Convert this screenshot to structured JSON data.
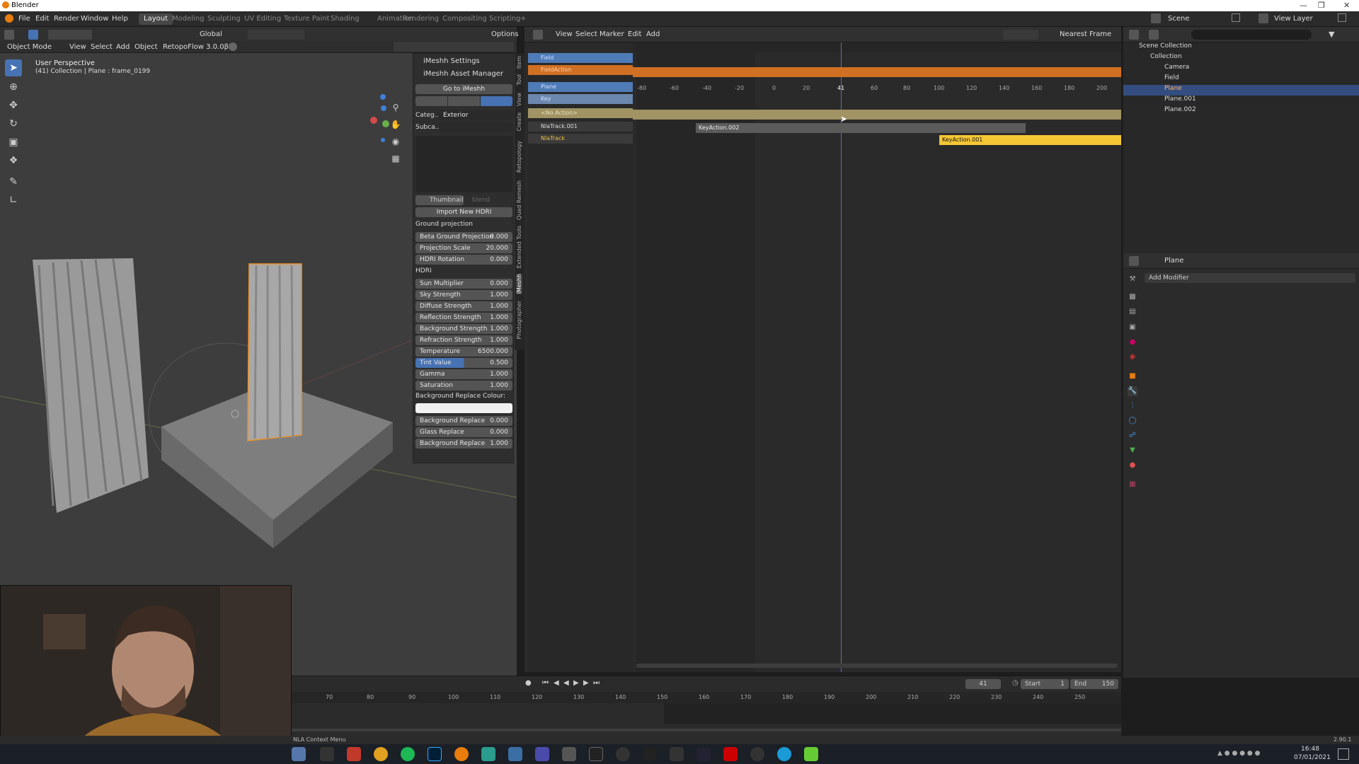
{
  "app": {
    "title": "Blender"
  },
  "menubar": [
    "File",
    "Edit",
    "Render",
    "Window",
    "Help"
  ],
  "workspaces": [
    "Layout",
    "Modeling",
    "Sculpting",
    "UV Editing",
    "Texture Paint",
    "Shading",
    "Animation",
    "Rendering",
    "Compositing",
    "Scripting",
    "+"
  ],
  "top_right": {
    "scene": "Scene",
    "view_layer": "View Layer"
  },
  "viewport": {
    "mode": "Object Mode",
    "menus": [
      "View",
      "Select",
      "Add",
      "Object"
    ],
    "transform": "Global",
    "addon": "RetopoFlow 3.0.0β2",
    "options": "Options",
    "overlay_title": "User Perspective",
    "overlay_sub": "(41) Collection | Plane : frame_0199"
  },
  "npanel": {
    "settings": "iMeshh Settings",
    "asset_manager": "iMeshh Asset Manager",
    "go_to": "Go to iMeshh",
    "category_label": "Categ...",
    "category_value": "Exterior",
    "subcategory_label": "Subca...",
    "subcategory_value": "",
    "thumbnail": "Thumbnail",
    "blend": "blend",
    "import_hdri": "Import New HDRI",
    "ground_projection": "Ground projection",
    "hdri_section": "HDRI",
    "bg_replace_colour": "Background Replace Colour:",
    "rows_top": [
      {
        "label": "Beta Ground Projection",
        "value": "0.000"
      },
      {
        "label": "Projection Scale",
        "value": "20.000"
      },
      {
        "label": "HDRI Rotation",
        "value": "0.000"
      }
    ],
    "rows_hdri": [
      {
        "label": "Sun Multiplier",
        "value": "0.000"
      },
      {
        "label": "Sky Strength",
        "value": "1.000"
      },
      {
        "label": "Diffuse Strength",
        "value": "1.000"
      },
      {
        "label": "Reflection Strength",
        "value": "1.000"
      },
      {
        "label": "Background Strength",
        "value": "1.000"
      },
      {
        "label": "Refraction Strength",
        "value": "1.000"
      },
      {
        "label": "Temperature",
        "value": "6500.000"
      },
      {
        "label": "Tint Value",
        "value": "0.500"
      },
      {
        "label": "Gamma",
        "value": "1.000"
      },
      {
        "label": "Saturation",
        "value": "1.000"
      }
    ],
    "rows_bottom": [
      {
        "label": "Background Replace",
        "value": "0.000"
      },
      {
        "label": "Glass Replace",
        "value": "0.000"
      },
      {
        "label": "Background Replace",
        "value": "1.000"
      }
    ],
    "vtabs": [
      "Item",
      "Tool",
      "View",
      "Create",
      "Retopology",
      "Quad Remesh",
      "Extended Tools",
      "iMeshh",
      "Photographer"
    ]
  },
  "nla": {
    "menus": [
      "View",
      "Select",
      "Marker",
      "Edit",
      "Add"
    ],
    "snap": "Nearest Frame",
    "ruler": [
      "-80",
      "-60",
      "-40",
      "-20",
      "0",
      "20",
      "41",
      "60",
      "80",
      "100",
      "120",
      "140",
      "160",
      "180",
      "200"
    ],
    "tracks": [
      {
        "name": "Field",
        "kind": "object"
      },
      {
        "name": "FieldAction",
        "kind": "action"
      },
      {
        "name": "Plane",
        "kind": "object"
      },
      {
        "name": "Key",
        "kind": "key"
      },
      {
        "name": "<No Action>",
        "kind": "noaction"
      },
      {
        "name": "NlaTrack.001",
        "kind": "track"
      },
      {
        "name": "NlaTrack",
        "kind": "track"
      }
    ],
    "strips": {
      "s1": "KeyAction.002",
      "s2": "KeyAction.001"
    }
  },
  "outliner": {
    "items": [
      {
        "label": "Scene Collection"
      },
      {
        "label": "Collection"
      },
      {
        "label": "Camera"
      },
      {
        "label": "Field"
      },
      {
        "label": "Plane"
      },
      {
        "label": "Plane.001"
      },
      {
        "label": "Plane.002"
      }
    ]
  },
  "properties": {
    "object": "Plane",
    "add_modifier": "Add Modifier"
  },
  "timeline": {
    "ticks": [
      "70",
      "80",
      "90",
      "100",
      "110",
      "120",
      "130",
      "140",
      "150",
      "160",
      "170",
      "180",
      "190",
      "200",
      "210",
      "220",
      "230",
      "240",
      "250"
    ],
    "current": "41",
    "start_label": "Start",
    "start": "1",
    "end_label": "End",
    "end": "150"
  },
  "status": {
    "left": "NLA Context Menu",
    "version": "2.90.1"
  },
  "taskbar": {
    "time": "16:48",
    "date": "07/01/2021"
  }
}
